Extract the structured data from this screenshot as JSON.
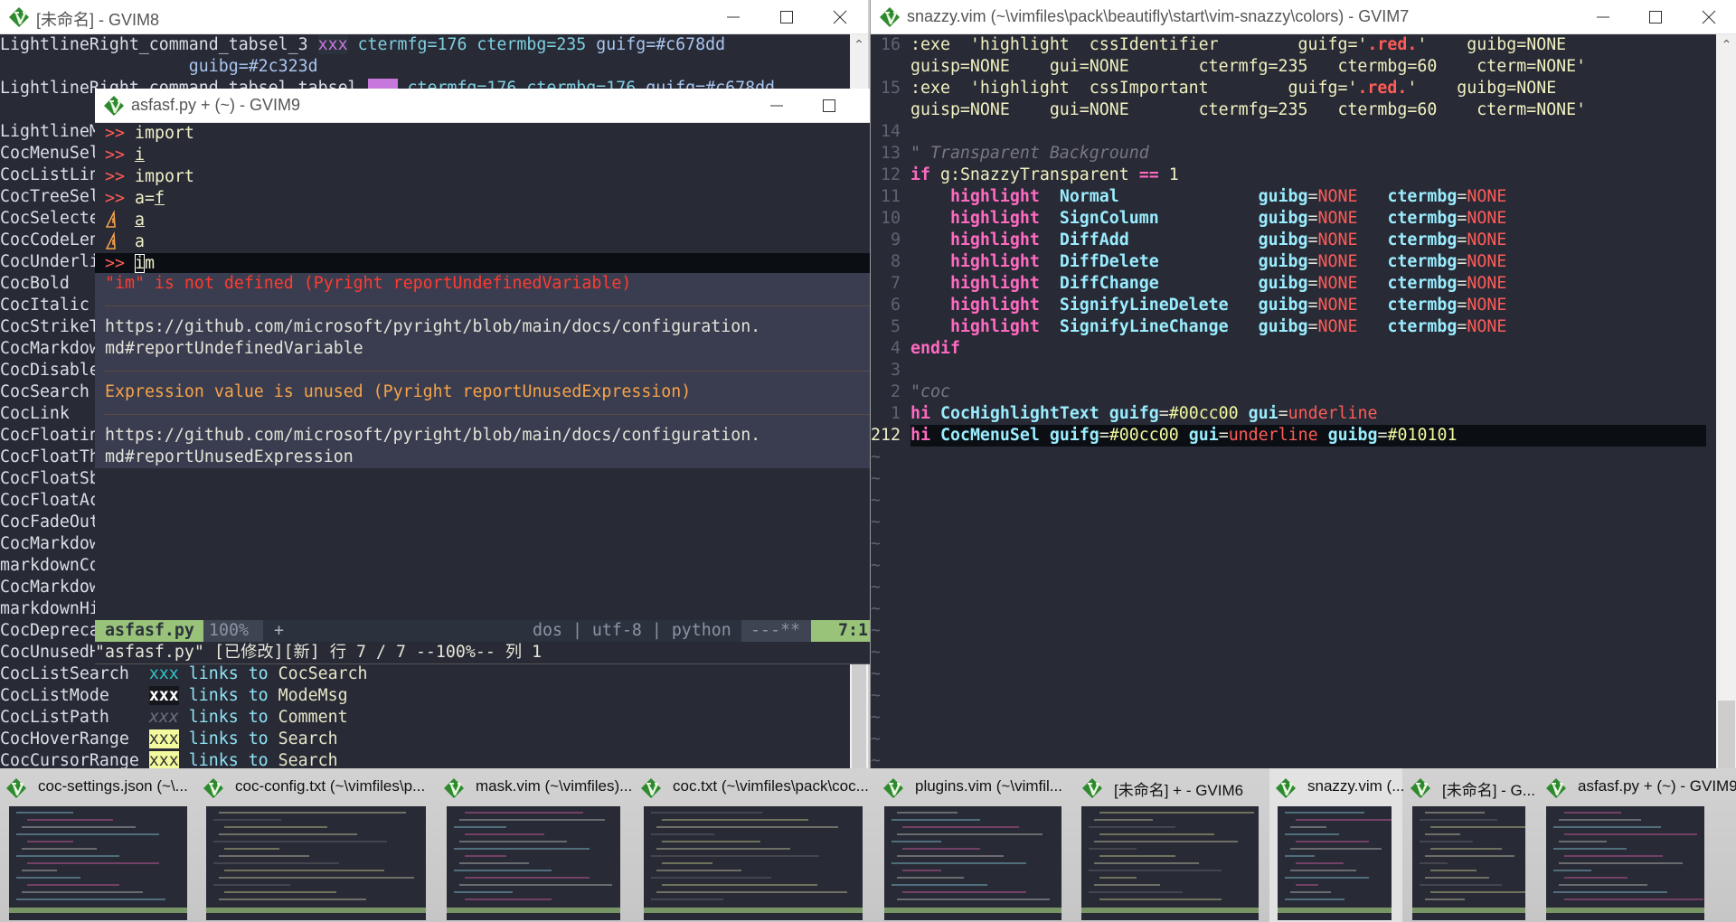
{
  "colors": {
    "background": "#282a36",
    "accent_green": "#98c379",
    "error": "#ff5c57",
    "pink": "#ff6ac1",
    "cyan": "#9aedfe",
    "yellow": "#f3f99d"
  },
  "gvim8": {
    "title": "[未命名] - GVIM8",
    "lines": [
      [
        [
          "LightlineRight_command_tabsel_3 ",
          "n"
        ],
        [
          "xxx",
          "xp"
        ],
        [
          " ctermfg=176 ctermbg=235 ",
          "ct"
        ],
        [
          "guifg=#c678dd",
          "gf"
        ]
      ],
      [
        [
          "                   ",
          "n"
        ],
        [
          "guibg=#2c323d",
          "gf"
        ]
      ],
      [
        [
          "LightlineRight_command_tabsel_tabsel ",
          "n"
        ],
        [
          "   ",
          "pbox"
        ],
        [
          " ctermfg=176 ctermbg=176 ",
          "ct"
        ],
        [
          "guifg=#c678dd",
          "gf"
        ]
      ],
      [],
      [
        [
          "LightlineM",
          "n"
        ]
      ],
      [
        [
          "CocMenuSel",
          "n"
        ]
      ],
      [
        [
          "CocListLin",
          "n"
        ]
      ],
      [
        [
          "CocTreeSel",
          "n"
        ]
      ],
      [
        [
          "CocSelecte",
          "n"
        ]
      ],
      [
        [
          "CocCodeLen",
          "n"
        ]
      ],
      [
        [
          "CocUnderli",
          "n"
        ]
      ],
      [
        [
          "CocBold",
          "n"
        ]
      ],
      [
        [
          "CocItalic",
          "n"
        ]
      ],
      [
        [
          "CocStrikeT",
          "n"
        ]
      ],
      [
        [
          "CocMarkdow",
          "n"
        ]
      ],
      [
        [
          "CocDisable",
          "n"
        ]
      ],
      [
        [
          "CocSearch",
          "n"
        ]
      ],
      [
        [
          "CocLink",
          "n"
        ]
      ],
      [
        [
          "CocFloatin",
          "n"
        ]
      ],
      [
        [
          "CocFloatTh",
          "n"
        ]
      ],
      [
        [
          "CocFloatSb",
          "n"
        ]
      ],
      [
        [
          "CocFloatAc",
          "n"
        ]
      ],
      [
        [
          "CocFadeOut",
          "n"
        ]
      ],
      [
        [
          "CocMarkdow",
          "n"
        ]
      ],
      [
        [
          "markdownCo",
          "n"
        ]
      ],
      [
        [
          "CocMarkdow",
          "n"
        ]
      ],
      [
        [
          "markdownHi",
          "n"
        ]
      ],
      [
        [
          "CocDepreca",
          "n"
        ]
      ],
      [
        [
          "CocUnusedH",
          "n"
        ]
      ],
      [
        [
          "CocListSearch  ",
          "n"
        ],
        [
          "xxx",
          "xs"
        ],
        [
          " links to ",
          "lk"
        ],
        [
          "CocSearch",
          "tg"
        ]
      ],
      [
        [
          "CocListMode    ",
          "n"
        ],
        [
          "xxx",
          "xm"
        ],
        [
          " links to ",
          "lk"
        ],
        [
          "ModeMsg",
          "tg"
        ]
      ],
      [
        [
          "CocListPath    ",
          "n"
        ],
        [
          "xxx",
          "xi"
        ],
        [
          " links to ",
          "lk"
        ],
        [
          "Comment",
          "tg"
        ]
      ],
      [
        [
          "CocHoverRange  ",
          "n"
        ],
        [
          "xxx",
          "xy"
        ],
        [
          " links to ",
          "lk"
        ],
        [
          "Search",
          "tg"
        ]
      ],
      [
        [
          "CocCursorRange ",
          "n"
        ],
        [
          "xxx",
          "xy"
        ],
        [
          " links to ",
          "lk"
        ],
        [
          "Search",
          "tg"
        ]
      ]
    ]
  },
  "gvim9": {
    "title": "asfasf.py + (~) - GVIM9",
    "lines": [
      {
        "sign": ">>",
        "sign_type": "error",
        "tokens": [
          [
            "import",
            "txt"
          ]
        ]
      },
      {
        "sign": ">>",
        "sign_type": "error",
        "tokens": [
          [
            "i",
            "ul"
          ]
        ]
      },
      {
        "sign": ">>",
        "sign_type": "error",
        "tokens": [
          [
            "import",
            "txt"
          ]
        ]
      },
      {
        "sign": ">>",
        "sign_type": "error",
        "tokens": [
          [
            "a=",
            "txt"
          ],
          [
            "f",
            "ul"
          ]
        ]
      },
      {
        "sign": "",
        "sign_type": "warning",
        "tokens": [
          [
            "a",
            "ul"
          ]
        ]
      },
      {
        "sign": "",
        "sign_type": "warning",
        "tokens": [
          [
            "a",
            "txt"
          ]
        ]
      },
      {
        "sign": ">>",
        "sign_type": "error",
        "tokens": [
          [
            "i",
            "cur"
          ],
          [
            "m",
            "txt"
          ]
        ],
        "cursorline": true
      }
    ],
    "diagnostics": {
      "error_message": "\"im\" is not defined (Pyright reportUndefinedVariable)",
      "error_url_1": "https://github.com/microsoft/pyright/blob/main/docs/configuration.",
      "error_url_2": "md#reportUndefinedVariable",
      "warning_message": "Expression value is unused (Pyright reportUnusedExpression)",
      "warning_url_1": "https://github.com/microsoft/pyright/blob/main/docs/configuration.",
      "warning_url_2": "md#reportUnusedExpression"
    },
    "statusline": {
      "filename": "asfasf.py",
      "percent": "100%",
      "modified": "+",
      "fileinfo": "dos | utf-8 | python",
      "flags": "---**",
      "position": "7:1"
    },
    "cmdline": "\"asfasf.py\" [已修改][新] 行 7 / 7 --100%-- 列 1"
  },
  "gvim7": {
    "title": "snazzy.vim (~\\vimfiles\\pack\\beautifly\\start\\vim-snazzy\\colors) - GVIM7",
    "lines": [
      {
        "num": "16",
        "tokens": [
          [
            ":exe  'highlight  cssIdentifier        guifg='",
            "s"
          ],
          [
            ".red.",
            "rd"
          ],
          [
            "'    guibg=NONE",
            "s"
          ]
        ]
      },
      {
        "num": "",
        "tokens": [
          [
            "guisp=NONE    gui=NONE       ctermfg=235   ctermbg=60    cterm=NONE'",
            "s"
          ]
        ]
      },
      {
        "num": "15",
        "tokens": [
          [
            ":exe  'highlight  cssImportant        guifg='",
            "s"
          ],
          [
            ".red.",
            "rd"
          ],
          [
            "'    guibg=NONE",
            "s"
          ]
        ]
      },
      {
        "num": "",
        "tokens": [
          [
            "guisp=NONE    gui=NONE       ctermfg=235   ctermbg=60    cterm=NONE'",
            "s"
          ]
        ]
      },
      {
        "num": "14",
        "tokens": []
      },
      {
        "num": "13",
        "tokens": [
          [
            "\" Transparent Background",
            "cm"
          ]
        ]
      },
      {
        "num": "12",
        "tokens": [
          [
            "if",
            "op"
          ],
          [
            " g:SnazzyTransparent ",
            "pl"
          ],
          [
            "==",
            "op"
          ],
          [
            " 1",
            "pl"
          ]
        ]
      },
      {
        "num": "11",
        "tokens": [
          [
            "    ",
            ""
          ],
          [
            "highlight",
            "kw"
          ],
          [
            "  ",
            ""
          ],
          [
            "Normal",
            "grp"
          ],
          [
            "              ",
            ""
          ],
          [
            "guibg",
            "kv"
          ],
          [
            "=",
            "eq"
          ],
          [
            "NONE",
            "none"
          ],
          [
            "   ",
            ""
          ],
          [
            "ctermbg",
            "kv"
          ],
          [
            "=",
            "eq"
          ],
          [
            "NONE",
            "none"
          ]
        ]
      },
      {
        "num": "10",
        "tokens": [
          [
            "    ",
            ""
          ],
          [
            "highlight",
            "kw"
          ],
          [
            "  ",
            ""
          ],
          [
            "SignColumn",
            "grp"
          ],
          [
            "          ",
            ""
          ],
          [
            "guibg",
            "kv"
          ],
          [
            "=",
            "eq"
          ],
          [
            "NONE",
            "none"
          ],
          [
            "   ",
            ""
          ],
          [
            "ctermbg",
            "kv"
          ],
          [
            "=",
            "eq"
          ],
          [
            "NONE",
            "none"
          ]
        ]
      },
      {
        "num": "9",
        "tokens": [
          [
            "    ",
            ""
          ],
          [
            "highlight",
            "kw"
          ],
          [
            "  ",
            ""
          ],
          [
            "DiffAdd",
            "grp"
          ],
          [
            "             ",
            ""
          ],
          [
            "guibg",
            "kv"
          ],
          [
            "=",
            "eq"
          ],
          [
            "NONE",
            "none"
          ],
          [
            "   ",
            ""
          ],
          [
            "ctermbg",
            "kv"
          ],
          [
            "=",
            "eq"
          ],
          [
            "NONE",
            "none"
          ]
        ]
      },
      {
        "num": "8",
        "tokens": [
          [
            "    ",
            ""
          ],
          [
            "highlight",
            "kw"
          ],
          [
            "  ",
            ""
          ],
          [
            "DiffDelete",
            "grp"
          ],
          [
            "          ",
            ""
          ],
          [
            "guibg",
            "kv"
          ],
          [
            "=",
            "eq"
          ],
          [
            "NONE",
            "none"
          ],
          [
            "   ",
            ""
          ],
          [
            "ctermbg",
            "kv"
          ],
          [
            "=",
            "eq"
          ],
          [
            "NONE",
            "none"
          ]
        ]
      },
      {
        "num": "7",
        "tokens": [
          [
            "    ",
            ""
          ],
          [
            "highlight",
            "kw"
          ],
          [
            "  ",
            ""
          ],
          [
            "DiffChange",
            "grp"
          ],
          [
            "          ",
            ""
          ],
          [
            "guibg",
            "kv"
          ],
          [
            "=",
            "eq"
          ],
          [
            "NONE",
            "none"
          ],
          [
            "   ",
            ""
          ],
          [
            "ctermbg",
            "kv"
          ],
          [
            "=",
            "eq"
          ],
          [
            "NONE",
            "none"
          ]
        ]
      },
      {
        "num": "6",
        "tokens": [
          [
            "    ",
            ""
          ],
          [
            "highlight",
            "kw"
          ],
          [
            "  ",
            ""
          ],
          [
            "SignifyLineDelete",
            "grp"
          ],
          [
            "   ",
            ""
          ],
          [
            "guibg",
            "kv"
          ],
          [
            "=",
            "eq"
          ],
          [
            "NONE",
            "none"
          ],
          [
            "   ",
            ""
          ],
          [
            "ctermbg",
            "kv"
          ],
          [
            "=",
            "eq"
          ],
          [
            "NONE",
            "none"
          ]
        ]
      },
      {
        "num": "5",
        "tokens": [
          [
            "    ",
            ""
          ],
          [
            "highlight",
            "kw"
          ],
          [
            "  ",
            ""
          ],
          [
            "SignifyLineChange",
            "grp"
          ],
          [
            "   ",
            ""
          ],
          [
            "guibg",
            "kv"
          ],
          [
            "=",
            "eq"
          ],
          [
            "NONE",
            "none"
          ],
          [
            "   ",
            ""
          ],
          [
            "ctermbg",
            "kv"
          ],
          [
            "=",
            "eq"
          ],
          [
            "NONE",
            "none"
          ]
        ]
      },
      {
        "num": "4",
        "tokens": [
          [
            "endif",
            "op"
          ]
        ]
      },
      {
        "num": "3",
        "tokens": []
      },
      {
        "num": "2",
        "tokens": [
          [
            "\"coc",
            "cm"
          ]
        ]
      },
      {
        "num": "1",
        "tokens": [
          [
            "hi",
            "op"
          ],
          [
            " ",
            ""
          ],
          [
            "CocHighlightText",
            "grp"
          ],
          [
            " ",
            ""
          ],
          [
            "guifg",
            "kv"
          ],
          [
            "=",
            "eq"
          ],
          [
            "#00cc00",
            "hx"
          ],
          [
            " ",
            ""
          ],
          [
            "gui",
            "kv"
          ],
          [
            "=",
            "eq"
          ],
          [
            "underline",
            "none"
          ]
        ]
      },
      {
        "num": "212",
        "current": true,
        "tokens": [
          [
            "hi",
            "op"
          ],
          [
            " ",
            ""
          ],
          [
            "CocMenuSel",
            "grp"
          ],
          [
            " ",
            ""
          ],
          [
            "guifg",
            "kv"
          ],
          [
            "=",
            "eq"
          ],
          [
            "#00cc00",
            "hx"
          ],
          [
            " ",
            ""
          ],
          [
            "gui",
            "kv"
          ],
          [
            "=",
            "eq"
          ],
          [
            "underline",
            "none"
          ],
          [
            " ",
            ""
          ],
          [
            "guibg",
            "kv"
          ],
          [
            "=",
            "eq"
          ],
          [
            "#010101",
            "hx"
          ]
        ]
      }
    ],
    "filler": "~"
  },
  "taskbar": {
    "items": [
      {
        "title": "coc-settings.json (~\\..."
      },
      {
        "title": "coc-config.txt (~\\vimfiles\\p..."
      },
      {
        "title": "mask.vim (~\\vimfiles)..."
      },
      {
        "title": "coc.txt (~\\vimfiles\\pack\\coc..."
      },
      {
        "title": "plugins.vim (~\\vimfil..."
      },
      {
        "title": "[未命名] + - GVIM6"
      },
      {
        "title": "snazzy.vim (...",
        "active": true
      },
      {
        "title": "[未命名] - G..."
      },
      {
        "title": "asfasf.py + (~) - GVIM9"
      }
    ]
  }
}
